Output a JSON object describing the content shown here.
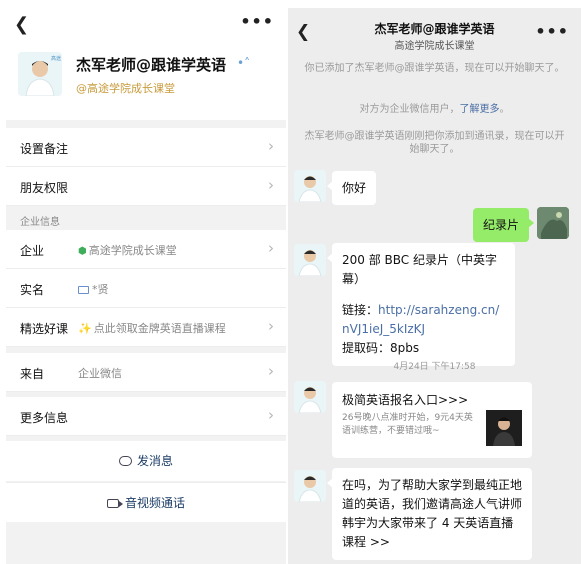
{
  "profile": {
    "back_icon": "back-chevron-icon",
    "more_icon": "more-dots-icon",
    "name": "杰军老师@跟谁学英语",
    "company": "@高途学院成长课堂",
    "rows": {
      "remark": "设置备注",
      "friend_permission": "朋友权限",
      "section_title": "企业信息",
      "enterprise_label": "企业",
      "enterprise_value": "高途学院成长课堂",
      "realname_label": "实名",
      "realname_value": "*贤",
      "course_label": "精选好课",
      "course_value": "点此领取金牌英语直播课程",
      "source_label": "来自",
      "source_value": "企业微信",
      "more_info": "更多信息"
    },
    "actions": {
      "send_message": "发消息",
      "video_call": "音视频通话"
    }
  },
  "chat": {
    "title": "杰军老师@跟谁学英语",
    "subtitle": "高途学院成长课堂",
    "system": {
      "added": "你已添加了杰军老师@跟谁学英语，现在可以开始聊天了。",
      "enterprise_prefix": "对方为企业微信用户，",
      "enterprise_link": "了解更多",
      "enterprise_suffix": "。",
      "contact": "杰军老师@跟谁学英语刚刚把你添加到通讯录，现在可以开始聊天了。"
    },
    "messages": {
      "hello": "你好",
      "documentary": "纪录片",
      "bbc_title": "200 部 BBC 纪录片（中英字幕）",
      "link_label": "链接：",
      "link_url_1": "http://sarahzeng.cn/",
      "link_url_2": "nVJ1ieJ_5kIzKJ",
      "code": "提取码：8pbs",
      "timestamp": "4月24日 下午17:58",
      "card_title": "极简英语报名入口>>>",
      "card_desc": "26号晚八点准时开始，9元4天英语训练营，不要错过哦~",
      "invite": "在吗，为了帮助大家学到最纯正地道的英语，我们邀请高途人气讲师韩宇为大家带来了 4 天英语直播课程 >>"
    }
  },
  "colors": {
    "accent_green": "#95ec69",
    "link_blue": "#4a6fa5",
    "company_gold": "#c89b3b",
    "verified_green": "#3fae5a"
  }
}
